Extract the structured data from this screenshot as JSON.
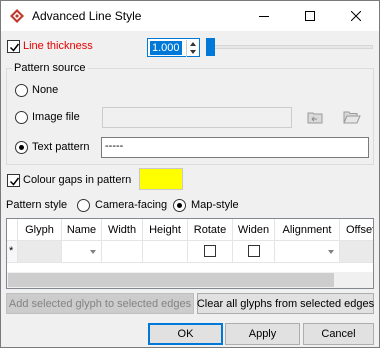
{
  "window": {
    "title": "Advanced Line Style",
    "controls": {
      "minimize": "minimize-icon",
      "maximize": "maximize-icon",
      "close": "close-icon"
    }
  },
  "line_thickness": {
    "label": "Line thickness",
    "checked": true,
    "value": "1.000",
    "slider_level": 0.0
  },
  "pattern_source": {
    "title": "Pattern source",
    "options": [
      {
        "label": "None",
        "selected": false
      },
      {
        "label": "Image file",
        "selected": false,
        "value": ""
      },
      {
        "label": "Text pattern",
        "selected": true,
        "value": "-----"
      }
    ]
  },
  "colour_gaps": {
    "label": "Colour gaps in pattern",
    "checked": true,
    "colour": "#ffff00"
  },
  "pattern_style": {
    "label": "Pattern style",
    "options": [
      {
        "label": "Camera-facing",
        "selected": false
      },
      {
        "label": "Map-style",
        "selected": true
      }
    ]
  },
  "glyph_table": {
    "columns": [
      "Glyph",
      "Name",
      "Width",
      "Height",
      "Rotate",
      "Widen",
      "Alignment",
      "Offset"
    ],
    "new_row_marker": "*"
  },
  "actions": {
    "add_glyph": "Add selected glyph to selected edges",
    "clear_glyphs": "Clear all glyphs from selected edges"
  },
  "footer": {
    "ok": "OK",
    "apply": "Apply",
    "cancel": "Cancel"
  },
  "colors": {
    "accent": "#0078d7",
    "label_highlight": "#e60000",
    "app_icon": "#c0392b"
  }
}
